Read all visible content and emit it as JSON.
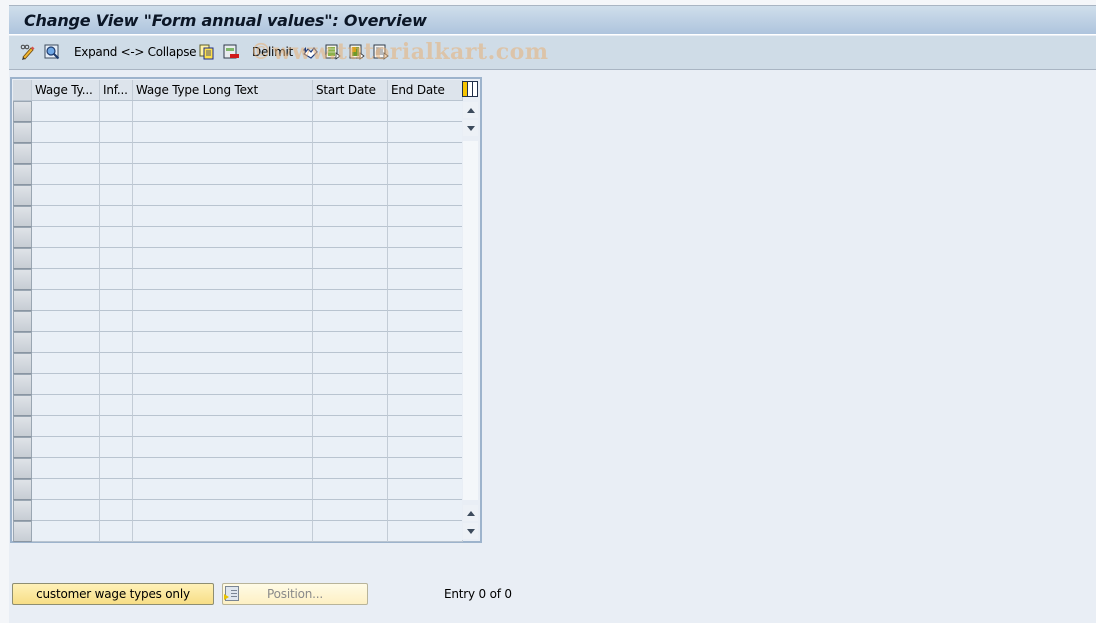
{
  "window": {
    "title": "Change View \"Form annual values\": Overview"
  },
  "toolbar": {
    "items": [
      {
        "name": "change-display-toggle",
        "icon": "pencil-glasses-icon",
        "label": ""
      },
      {
        "name": "select-details",
        "icon": "magnifier-icon",
        "label": ""
      },
      {
        "name": "expand-collapse",
        "icon": "",
        "label": "Expand <-> Collapse"
      },
      {
        "name": "copy-as",
        "icon": "copy-icon",
        "label": ""
      },
      {
        "name": "delete",
        "icon": "delete-row-icon",
        "label": ""
      },
      {
        "name": "delimit",
        "icon": "",
        "label": "Delimit"
      },
      {
        "name": "undo-change",
        "icon": "undo-icon",
        "label": ""
      },
      {
        "name": "select-all",
        "icon": "select-all-icon",
        "label": ""
      },
      {
        "name": "select-block",
        "icon": "select-block-icon",
        "label": ""
      },
      {
        "name": "deselect-all",
        "icon": "deselect-all-icon",
        "label": ""
      }
    ]
  },
  "watermark": "©www.tutorialkart.com",
  "table": {
    "columns": [
      {
        "key": "wage_type",
        "label": "Wage Ty..."
      },
      {
        "key": "infotype",
        "label": "Inf..."
      },
      {
        "key": "long_text",
        "label": "Wage Type Long Text"
      },
      {
        "key": "start_date",
        "label": "Start Date"
      },
      {
        "key": "end_date",
        "label": "End Date"
      }
    ],
    "rows": [],
    "visible_empty_rows": 21
  },
  "buttons": {
    "customer_wage_types": "customer wage types only",
    "position": "Position..."
  },
  "status": {
    "entry": "Entry 0 of 0"
  }
}
